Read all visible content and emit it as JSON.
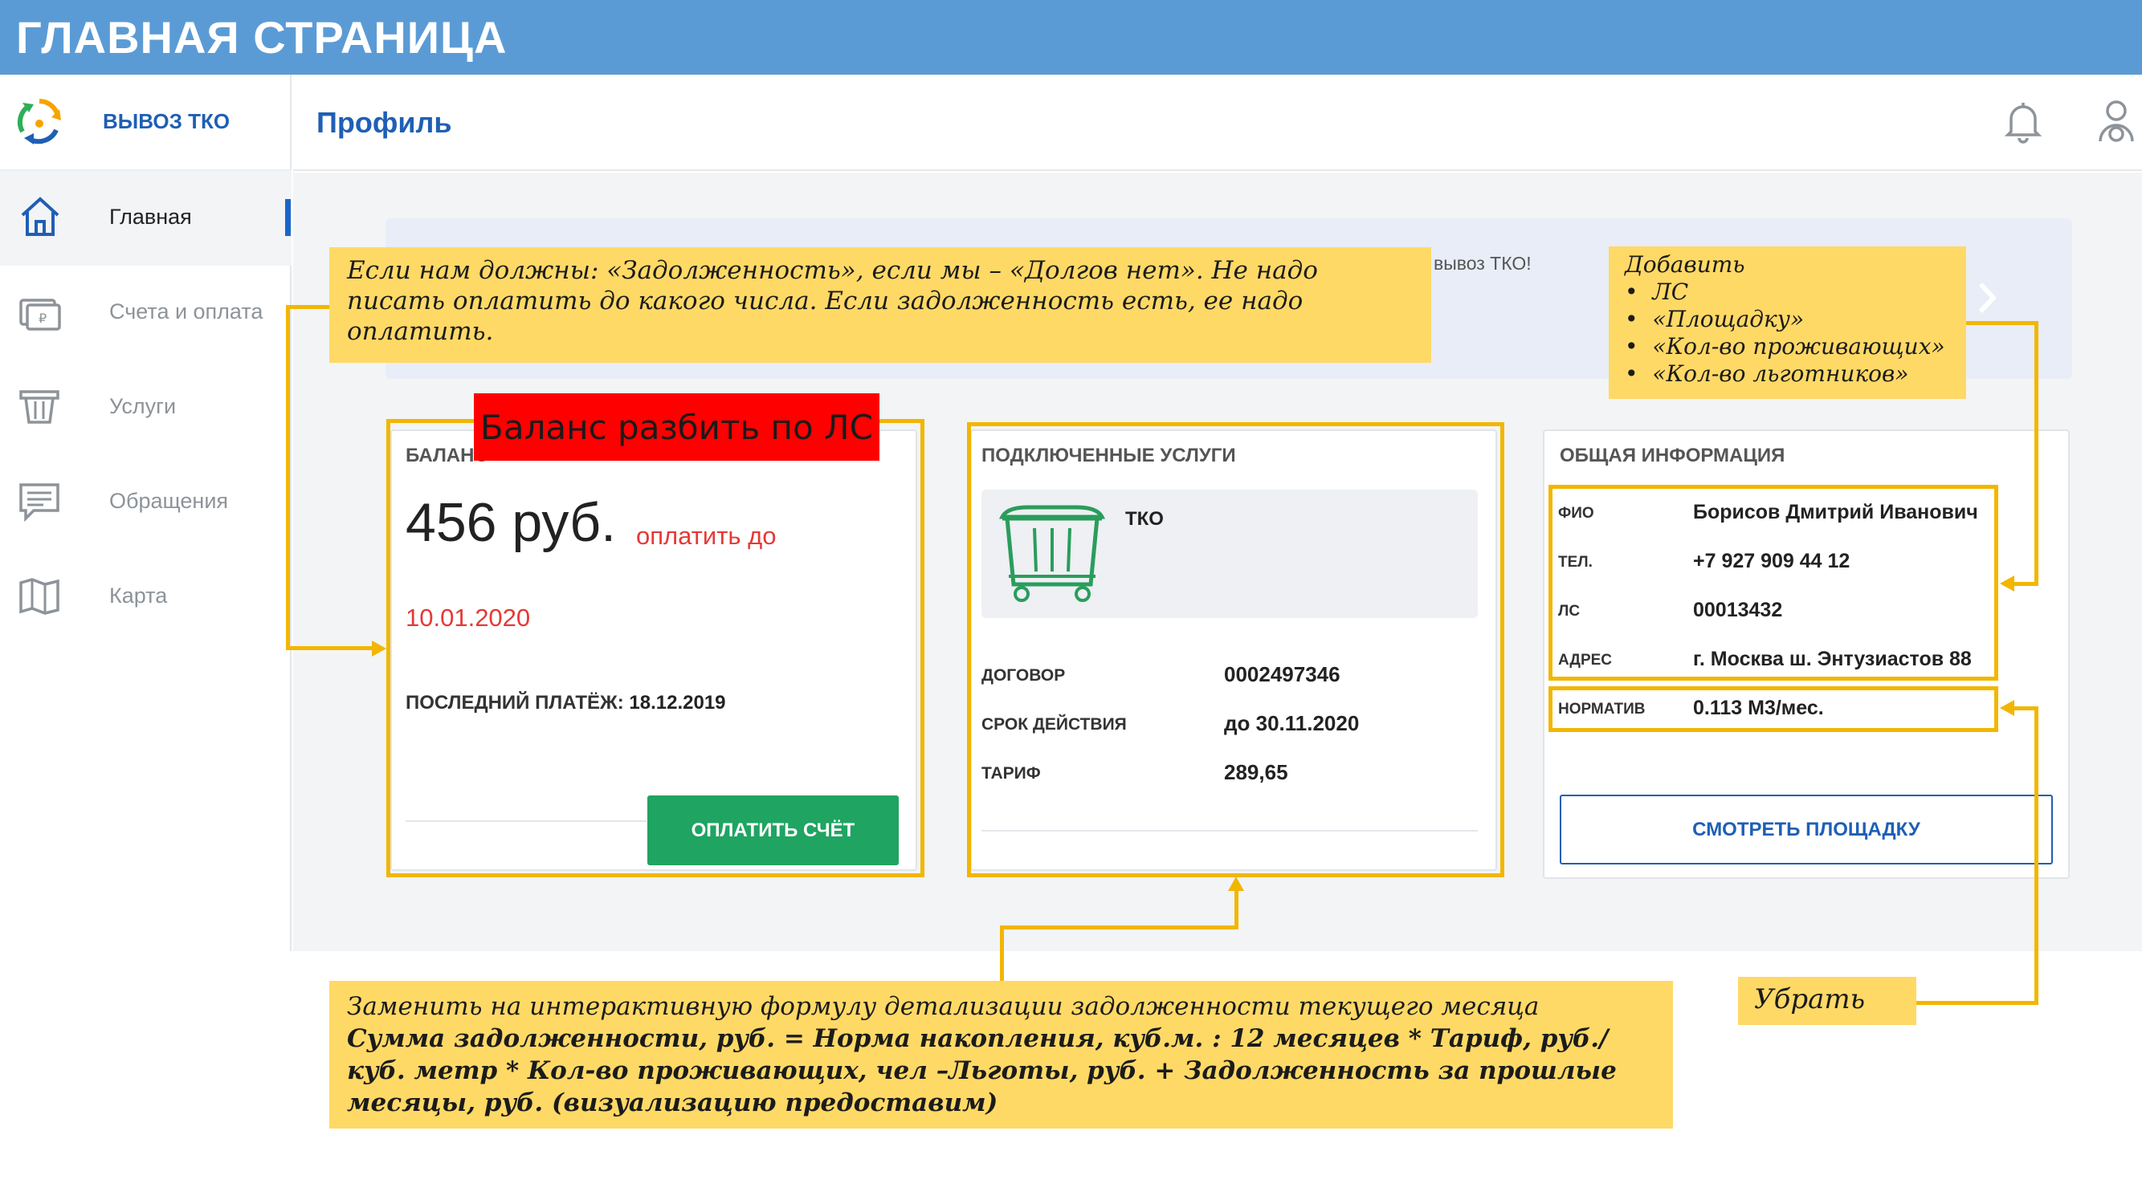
{
  "slide_title": "ГЛАВНАЯ СТРАНИЦА",
  "app": {
    "logo_text": "ВЫВОЗ ТКО"
  },
  "sidebar": {
    "items": [
      {
        "label": "Главная",
        "icon": "home-icon",
        "active": true
      },
      {
        "label": "Счета и оплата",
        "icon": "bills-icon",
        "active": false
      },
      {
        "label": "Услуги",
        "icon": "services-icon",
        "active": false
      },
      {
        "label": "Обращения",
        "icon": "messages-icon",
        "active": false
      },
      {
        "label": "Карта",
        "icon": "map-icon",
        "active": false
      }
    ]
  },
  "header": {
    "title": "Профиль",
    "icons": [
      "bell-icon",
      "user-icon"
    ]
  },
  "banner": {
    "text": "вывоз ТКО!"
  },
  "balance": {
    "title": "БАЛАНС",
    "amount": "456 руб.",
    "pay_until_label": "оплатить до",
    "pay_until_date": "10.01.2020",
    "last_payment_label": "ПОСЛЕДНИЙ ПЛАТЁЖ:",
    "last_payment_date": "18.12.2019",
    "pay_button": "ОПЛАТИТЬ СЧЁТ"
  },
  "services": {
    "title": "ПОДКЛЮЧЕННЫЕ УСЛУГИ",
    "service_name": "ТКО",
    "rows": [
      {
        "label": "ДОГОВОР",
        "value": "0002497346"
      },
      {
        "label": "СРОК ДЕЙСТВИЯ",
        "value": "до 30.11.2020"
      },
      {
        "label": "ТАРИФ",
        "value": "289,65"
      }
    ]
  },
  "info": {
    "title": "ОБЩАЯ ИНФОРМАЦИЯ",
    "rows": [
      {
        "label": "ФИО",
        "value": "Борисов Дмитрий Иванович"
      },
      {
        "label": "ТЕЛ.",
        "value": "+7 927 909 44 12"
      },
      {
        "label": "ЛС",
        "value": "00013432"
      },
      {
        "label": "АДРЕС",
        "value": "г. Москва ш. Энтузиастов 88"
      },
      {
        "label": "НОРМАТИВ",
        "value": "0.113 М3/мес."
      }
    ],
    "button": "СМОТРЕТЬ ПЛОЩАДКУ"
  },
  "annotations": {
    "debt_note": "Если нам должны: «Задолженность», если мы – «Долгов нет». Не надо писать оплатить до какого числа. Если задолженность есть, ее надо оплатить.",
    "balance_split": "Баланс разбить по ЛС",
    "add_title": "Добавить",
    "add_items": [
      "ЛС",
      "«Площадку»",
      "«Кол-во проживающих»",
      "«Кол-во льготников»"
    ],
    "remove": "Убрать",
    "formula_line1": "Заменить на интерактивную формулу детализации задолженности текущего месяца",
    "formula_line2": "Сумма задолженности, руб. = Норма накопления, куб.м. : 12 месяцев * Тариф, руб./куб. метр * Кол-во проживающих, чел –Льготы, руб. + Задолженность за прошлые месяцы, руб. (визуализацию предоставим)"
  },
  "colors": {
    "brand_blue": "#1f5fb5",
    "slide_bar": "#5b9bd5",
    "accent_green": "#1fa462",
    "annotation_yellow": "#ffd966",
    "highlight_border": "#f2b600",
    "alert_red": "#ff0000",
    "due_red": "#e53935"
  }
}
